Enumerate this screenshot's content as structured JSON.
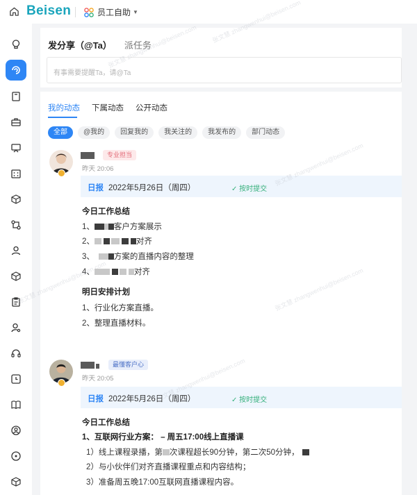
{
  "topbar": {
    "logo": "Beisen",
    "app_name": "员工自助"
  },
  "sidebar": {
    "items": [
      "lightbulb-icon",
      "feed-icon",
      "document-icon",
      "briefcase-icon",
      "monitor-icon",
      "calendar-grid-icon",
      "cube-icon",
      "workflow-icon",
      "person-icon",
      "cube-icon",
      "clipboard-icon",
      "person-gear-icon",
      "headset-icon",
      "clock-icon",
      "book-icon",
      "account-icon",
      "compass-icon",
      "cube-icon"
    ]
  },
  "share": {
    "tab_share": "发分享（@Ta）",
    "tab_task": "派任务",
    "placeholder": "有事需要提醒Ta，请@Ta"
  },
  "feed": {
    "tabs": [
      "我的动态",
      "下属动态",
      "公开动态"
    ],
    "filters": [
      "全部",
      "@我的",
      "回复我的",
      "我关注的",
      "我发布的",
      "部门动态"
    ]
  },
  "posts": [
    {
      "tag": "专业担当",
      "time": "昨天 20:06",
      "report_kind": "日报",
      "report_date": "2022年5月26日（周四）",
      "report_status": "按时提交",
      "today_title": "今日工作总结",
      "today_lines": [
        "1、",
        "客户方案展示",
        "2、",
        "对齐",
        "3、",
        "方案的直播内容的整理",
        "4、",
        "对齐"
      ],
      "plan_title": "明日安排计划",
      "plan_lines": [
        "1、行业化方案直播。",
        "2、整理直播材料。"
      ]
    },
    {
      "tag": "最懂客户心",
      "time": "昨天 20:05",
      "report_kind": "日报",
      "report_date": "2022年5月26日（周四）",
      "report_status": "按时提交",
      "today_title": "今日工作总结",
      "lines": [
        "1、互联网行业方案： – 周五17:00线上直播课",
        "1）线上课程录播，第",
        "次课程超长90分钟，第二次50分钟，",
        "2）与小伙伴们对齐直播课程重点和内容结构；",
        "3）准备周五晚17:00互联网直播课程内容。"
      ]
    }
  ],
  "colors": {
    "accent": "#2e86f5",
    "logo": "#1aa5bc",
    "success": "#36b07c",
    "page_bg": "#f3f4f6"
  }
}
